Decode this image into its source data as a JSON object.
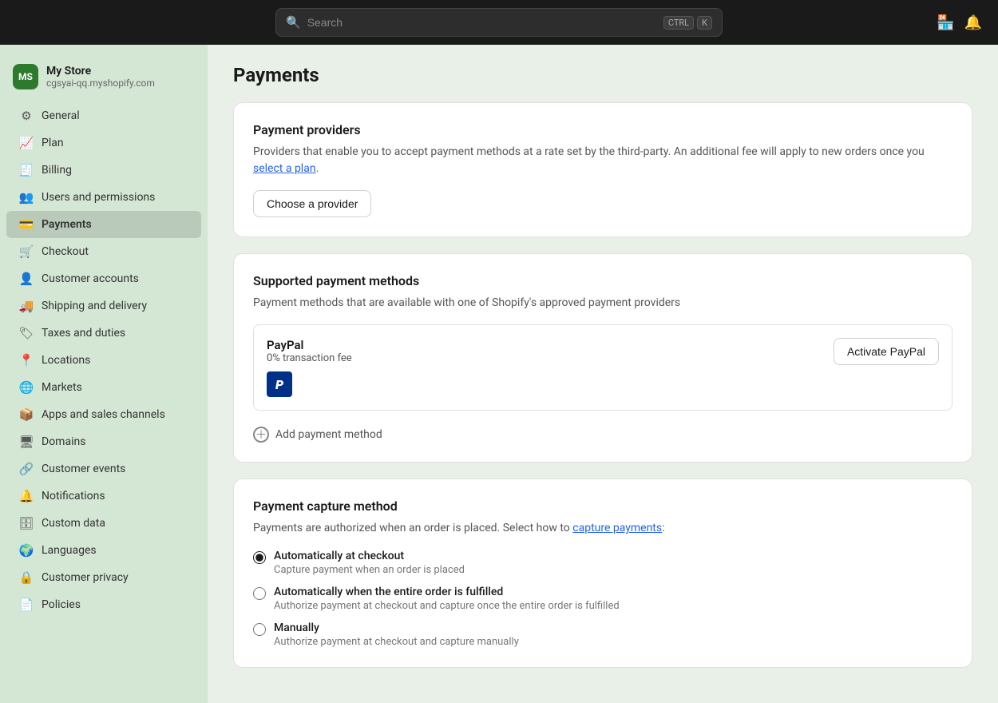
{
  "topbar": {
    "search_placeholder": "Search",
    "shortcut_ctrl": "CTRL",
    "shortcut_key": "K"
  },
  "sidebar": {
    "store_name": "My Store",
    "store_initials": "MS",
    "store_domain": "cgsyai-qq.myshopify.com",
    "items": [
      {
        "id": "general",
        "label": "General",
        "icon": "⚙"
      },
      {
        "id": "plan",
        "label": "Plan",
        "icon": "📈"
      },
      {
        "id": "billing",
        "label": "Billing",
        "icon": "🧾"
      },
      {
        "id": "users",
        "label": "Users and permissions",
        "icon": "👥"
      },
      {
        "id": "payments",
        "label": "Payments",
        "icon": "💳",
        "active": true
      },
      {
        "id": "checkout",
        "label": "Checkout",
        "icon": "🛒"
      },
      {
        "id": "customer-accounts",
        "label": "Customer accounts",
        "icon": "👤"
      },
      {
        "id": "shipping",
        "label": "Shipping and delivery",
        "icon": "🚚"
      },
      {
        "id": "taxes",
        "label": "Taxes and duties",
        "icon": "🏷"
      },
      {
        "id": "locations",
        "label": "Locations",
        "icon": "📍"
      },
      {
        "id": "markets",
        "label": "Markets",
        "icon": "🌐"
      },
      {
        "id": "apps",
        "label": "Apps and sales channels",
        "icon": "📦"
      },
      {
        "id": "domains",
        "label": "Domains",
        "icon": "🖥"
      },
      {
        "id": "customer-events",
        "label": "Customer events",
        "icon": "🔗"
      },
      {
        "id": "notifications",
        "label": "Notifications",
        "icon": "🔔"
      },
      {
        "id": "custom-data",
        "label": "Custom data",
        "icon": "🗄"
      },
      {
        "id": "languages",
        "label": "Languages",
        "icon": "🌍"
      },
      {
        "id": "customer-privacy",
        "label": "Customer privacy",
        "icon": "🔒"
      },
      {
        "id": "policies",
        "label": "Policies",
        "icon": "📄"
      }
    ]
  },
  "page": {
    "title": "Payments",
    "providers_card": {
      "title": "Payment providers",
      "description_part1": "Providers that enable you to accept payment methods at a rate set by the third-party. An additional fee will apply to new orders once you ",
      "description_link": "select a plan",
      "description_part2": ".",
      "button_label": "Choose a provider"
    },
    "supported_card": {
      "title": "Supported payment methods",
      "description": "Payment methods that are available with one of Shopify's approved payment providers",
      "paypal": {
        "name": "PayPal",
        "fee": "0% transaction fee",
        "button_label": "Activate PayPal",
        "logo_text": "P"
      },
      "add_method_label": "Add payment method"
    },
    "capture_card": {
      "title": "Payment capture method",
      "description_part1": "Payments are authorized when an order is placed. Select how to ",
      "description_link": "capture payments",
      "description_part2": ":",
      "options": [
        {
          "id": "auto-checkout",
          "label": "Automatically at checkout",
          "sublabel": "Capture payment when an order is placed",
          "checked": true
        },
        {
          "id": "auto-fulfilled",
          "label": "Automatically when the entire order is fulfilled",
          "sublabel": "Authorize payment at checkout and capture once the entire order is fulfilled",
          "checked": false
        },
        {
          "id": "manually",
          "label": "Manually",
          "sublabel": "Authorize payment at checkout and capture manually",
          "checked": false
        }
      ]
    }
  }
}
